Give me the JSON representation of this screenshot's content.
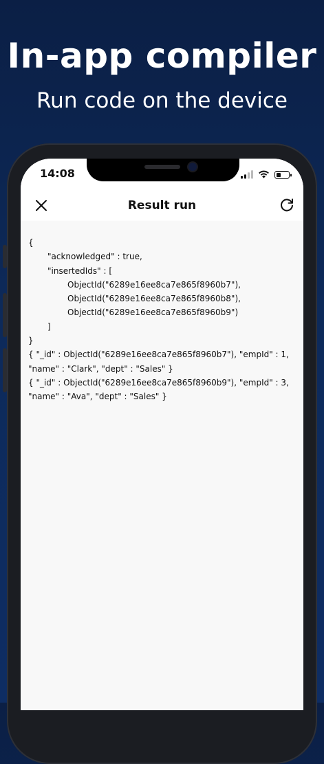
{
  "promo": {
    "title": "In-app compiler",
    "subtitle": "Run code on the device"
  },
  "status_bar": {
    "time": "14:08",
    "icons": [
      "signal-icon",
      "wifi-icon",
      "battery-icon"
    ],
    "battery_level": 0.4
  },
  "navbar": {
    "title": "Result run",
    "close_icon": "close-icon",
    "refresh_icon": "refresh-icon"
  },
  "output": {
    "lines": [
      "{",
      "\"acknowledged\" : true,",
      "\"insertedIds\" : [",
      "ObjectId(\"6289e16ee8ca7e865f8960b7\"),",
      "ObjectId(\"6289e16ee8ca7e865f8960b8\"),",
      "ObjectId(\"6289e16ee8ca7e865f8960b9\")",
      "]",
      "}",
      "{ \"_id\" : ObjectId(\"6289e16ee8ca7e865f8960b7\"), \"empId\" : 1, \"name\" : \"Clark\", \"dept\" : \"Sales\" }",
      "{ \"_id\" : ObjectId(\"6289e16ee8ca7e865f8960b9\"), \"empId\" : 3, \"name\" : \"Ava\", \"dept\" : \"Sales\" }"
    ]
  },
  "colors": {
    "background": "#0d2a5a",
    "screen": "#f8f8f8",
    "text": "#111111"
  }
}
